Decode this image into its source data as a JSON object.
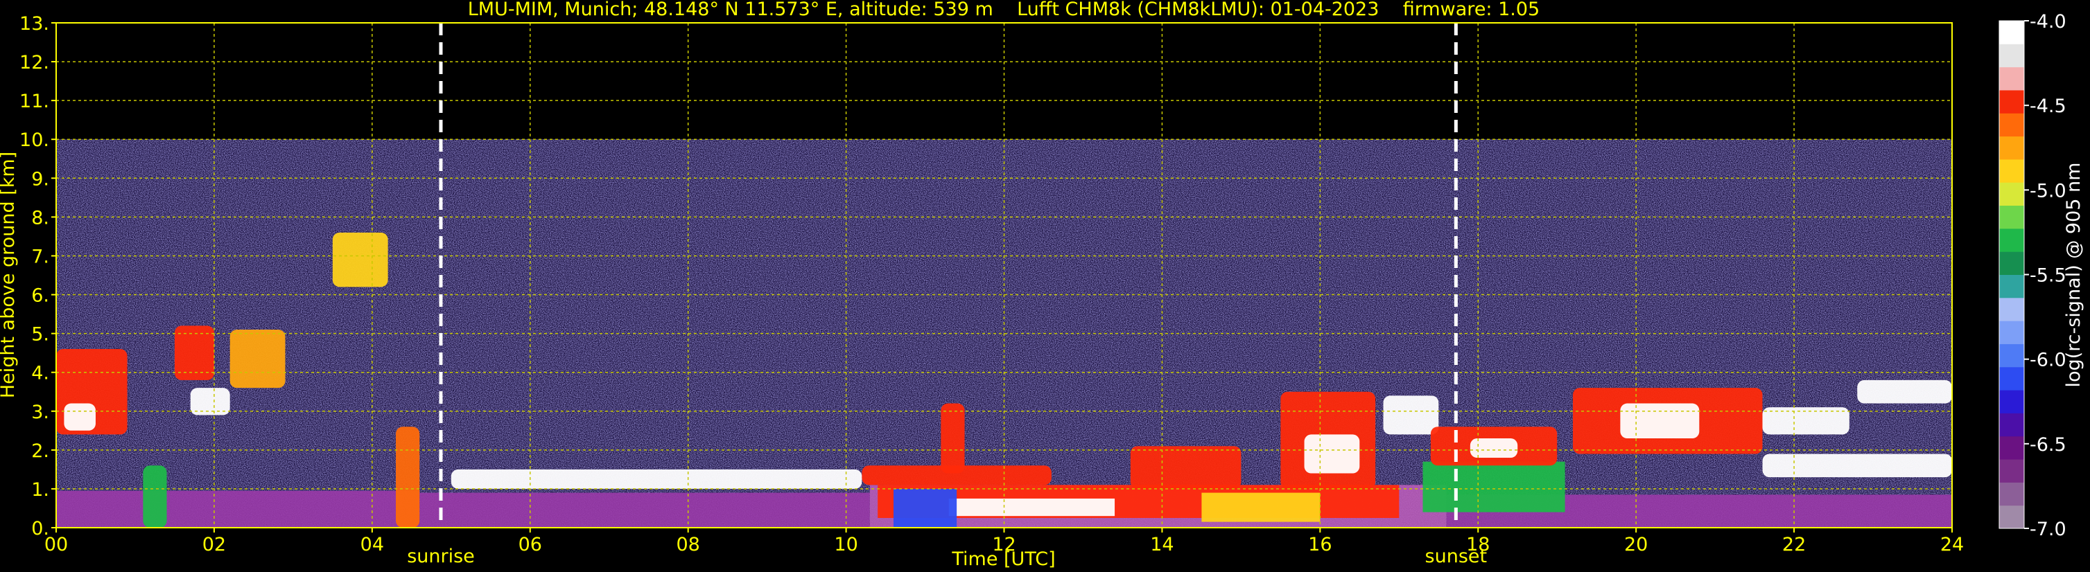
{
  "chart_data": {
    "type": "heatmap",
    "title": "LMU-MIM, Munich; 48.148° N 11.573° E, altitude: 539 m    Lufft CHM8k (CHM8kLMU): 01-04-2023    firmware: 1.05",
    "xlabel": "Time [UTC]",
    "ylabel": "Height above ground [km]",
    "xlim": [
      0,
      24
    ],
    "ylim": [
      0,
      13
    ],
    "x_ticks": [
      "00",
      "02",
      "04",
      "06",
      "08",
      "10",
      "12",
      "14",
      "16",
      "18",
      "20",
      "22",
      "24"
    ],
    "y_ticks": [
      "0.",
      "1.",
      "2.",
      "3.",
      "4.",
      "5.",
      "6.",
      "7.",
      "8.",
      "9.",
      "10.",
      "11.",
      "12.",
      "13."
    ],
    "grid": true,
    "data_top_km": 10,
    "markers": [
      {
        "label": "sunrise",
        "time": 4.87
      },
      {
        "label": "sunset",
        "time": 17.72
      }
    ],
    "colorbar": {
      "label": "log(rc-signal) @ 905 nm",
      "min": -7.0,
      "max": -4.0,
      "ticks": [
        "-4.0",
        "-4.5",
        "-5.0",
        "-5.5",
        "-6.0",
        "-6.5",
        "-7.0"
      ],
      "colors": [
        "#a08aa8",
        "#8c5f98",
        "#7a2d87",
        "#6a1282",
        "#4b0fa8",
        "#2a1bd6",
        "#2d4cf2",
        "#4f7bf5",
        "#7d9ff7",
        "#a9bdf5",
        "#2fa4a0",
        "#168f50",
        "#1fb84a",
        "#6ed64a",
        "#d8e838",
        "#ffd21a",
        "#ffa50f",
        "#ff6a0a",
        "#f52a0a",
        "#f4b0b0",
        "#e4e4e4",
        "#ffffff"
      ]
    },
    "features": [
      {
        "kind": "boundary_layer",
        "t0": 0.0,
        "t1": 4.6,
        "h0": 0.0,
        "h1": 0.95,
        "color": "#9a3aa8"
      },
      {
        "kind": "boundary_layer",
        "t0": 4.6,
        "t1": 10.3,
        "h0": 0.0,
        "h1": 0.9,
        "color": "#9a3aa8"
      },
      {
        "kind": "boundary_layer",
        "t0": 10.3,
        "t1": 17.6,
        "h0": 0.0,
        "h1": 1.1,
        "color": "#b85cb8"
      },
      {
        "kind": "boundary_layer",
        "t0": 17.6,
        "t1": 24.0,
        "h0": 0.0,
        "h1": 0.85,
        "color": "#9a3aa8"
      },
      {
        "kind": "aerosol",
        "t0": 10.4,
        "t1": 17.0,
        "h0": 0.25,
        "h1": 1.1,
        "color": "#ff2a0a"
      },
      {
        "kind": "aerosol",
        "t0": 11.3,
        "t1": 13.4,
        "h0": 0.3,
        "h1": 0.75,
        "color": "#ffffff"
      },
      {
        "kind": "aerosol",
        "t0": 10.6,
        "t1": 11.4,
        "h0": 0.0,
        "h1": 1.0,
        "color": "#2d4cf2"
      },
      {
        "kind": "aerosol",
        "t0": 14.5,
        "t1": 16.0,
        "h0": 0.15,
        "h1": 0.9,
        "color": "#ffd21a"
      },
      {
        "kind": "aerosol",
        "t0": 17.3,
        "t1": 19.1,
        "h0": 0.4,
        "h1": 1.7,
        "color": "#1fb84a"
      },
      {
        "kind": "cloud",
        "t0": 0.0,
        "t1": 0.9,
        "h0": 2.4,
        "h1": 4.6,
        "color": "#ff2a0a"
      },
      {
        "kind": "cloud",
        "t0": 0.1,
        "t1": 0.5,
        "h0": 2.5,
        "h1": 3.2,
        "color": "#ffffff"
      },
      {
        "kind": "cloud",
        "t0": 1.5,
        "t1": 2.0,
        "h0": 3.8,
        "h1": 5.2,
        "color": "#ff2a0a"
      },
      {
        "kind": "cloud",
        "t0": 2.2,
        "t1": 2.9,
        "h0": 3.6,
        "h1": 5.1,
        "color": "#ffa50f"
      },
      {
        "kind": "cloud",
        "t0": 1.7,
        "t1": 2.2,
        "h0": 2.9,
        "h1": 3.6,
        "color": "#ffffff"
      },
      {
        "kind": "cloud",
        "t0": 3.5,
        "t1": 4.2,
        "h0": 6.2,
        "h1": 7.6,
        "color": "#ffd21a"
      },
      {
        "kind": "cloud",
        "t0": 1.1,
        "t1": 1.4,
        "h0": 0.0,
        "h1": 1.6,
        "color": "#1fb84a"
      },
      {
        "kind": "cloud",
        "t0": 4.3,
        "t1": 4.6,
        "h0": 0.0,
        "h1": 2.6,
        "color": "#ff6a0a"
      },
      {
        "kind": "cloud",
        "t0": 5.0,
        "t1": 10.2,
        "h0": 1.0,
        "h1": 1.5,
        "color": "#ffffff"
      },
      {
        "kind": "cloud",
        "t0": 10.2,
        "t1": 12.6,
        "h0": 1.1,
        "h1": 1.6,
        "color": "#ff2a0a"
      },
      {
        "kind": "cloud",
        "t0": 11.2,
        "t1": 11.5,
        "h0": 1.4,
        "h1": 3.2,
        "color": "#ff2a0a"
      },
      {
        "kind": "cloud",
        "t0": 13.6,
        "t1": 15.0,
        "h0": 1.0,
        "h1": 2.1,
        "color": "#ff2a0a"
      },
      {
        "kind": "cloud",
        "t0": 15.5,
        "t1": 16.7,
        "h0": 1.0,
        "h1": 3.5,
        "color": "#ff2a0a"
      },
      {
        "kind": "cloud",
        "t0": 15.8,
        "t1": 16.5,
        "h0": 1.4,
        "h1": 2.4,
        "color": "#ffffff"
      },
      {
        "kind": "cloud",
        "t0": 16.8,
        "t1": 17.5,
        "h0": 2.4,
        "h1": 3.4,
        "color": "#ffffff"
      },
      {
        "kind": "cloud",
        "t0": 17.4,
        "t1": 19.0,
        "h0": 1.6,
        "h1": 2.6,
        "color": "#ff2a0a"
      },
      {
        "kind": "cloud",
        "t0": 17.9,
        "t1": 18.5,
        "h0": 1.8,
        "h1": 2.3,
        "color": "#ffffff"
      },
      {
        "kind": "cloud",
        "t0": 19.2,
        "t1": 21.6,
        "h0": 1.9,
        "h1": 3.6,
        "color": "#ff2a0a"
      },
      {
        "kind": "cloud",
        "t0": 19.8,
        "t1": 20.8,
        "h0": 2.3,
        "h1": 3.2,
        "color": "#ffffff"
      },
      {
        "kind": "cloud",
        "t0": 21.6,
        "t1": 22.7,
        "h0": 2.4,
        "h1": 3.1,
        "color": "#ffffff"
      },
      {
        "kind": "cloud",
        "t0": 22.8,
        "t1": 24.0,
        "h0": 3.2,
        "h1": 3.8,
        "color": "#ffffff"
      },
      {
        "kind": "cloud",
        "t0": 21.6,
        "t1": 24.0,
        "h0": 1.3,
        "h1": 1.9,
        "color": "#ffffff"
      }
    ]
  }
}
